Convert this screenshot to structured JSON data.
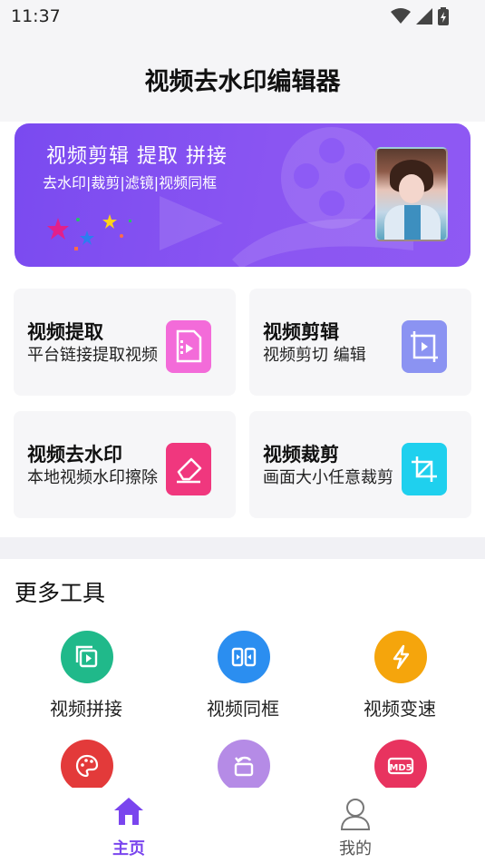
{
  "status": {
    "time": "11:37"
  },
  "header": {
    "title": "视频去水印编辑器"
  },
  "banner": {
    "title": "视频剪辑  提取  拼接",
    "subtitle": "去水印|裁剪|滤镜|视频同框"
  },
  "features": [
    {
      "title": "视频提取",
      "desc": "平台链接提取视频",
      "icon": "video-file-icon",
      "color": "#f36bd9"
    },
    {
      "title": "视频剪辑",
      "desc": "视频剪切 编辑",
      "icon": "crop-frame-icon",
      "color": "#8b93f2"
    },
    {
      "title": "视频去水印",
      "desc": "本地视频水印擦除",
      "icon": "eraser-icon",
      "color": "#f0377e"
    },
    {
      "title": "视频裁剪",
      "desc": "画面大小任意裁剪",
      "icon": "crop-icon",
      "color": "#1fd0ee"
    }
  ],
  "more": {
    "title": "更多工具",
    "tools": [
      {
        "label": "视频拼接",
        "icon": "video-merge-icon",
        "color": "#20b98a"
      },
      {
        "label": "视频同框",
        "icon": "split-frame-icon",
        "color": "#2b8ef0"
      },
      {
        "label": "视频变速",
        "icon": "lightning-icon",
        "color": "#f5a50c"
      },
      {
        "label": "",
        "icon": "palette-icon",
        "color": "#e33a3a"
      },
      {
        "label": "",
        "icon": "rotate-icon",
        "color": "#b58be6"
      },
      {
        "label": "",
        "icon": "md5-icon",
        "color": "#e8335f"
      }
    ]
  },
  "nav": {
    "home": {
      "label": "主页",
      "color": "#7a45ee"
    },
    "mine": {
      "label": "我的",
      "color": "#555555"
    }
  }
}
